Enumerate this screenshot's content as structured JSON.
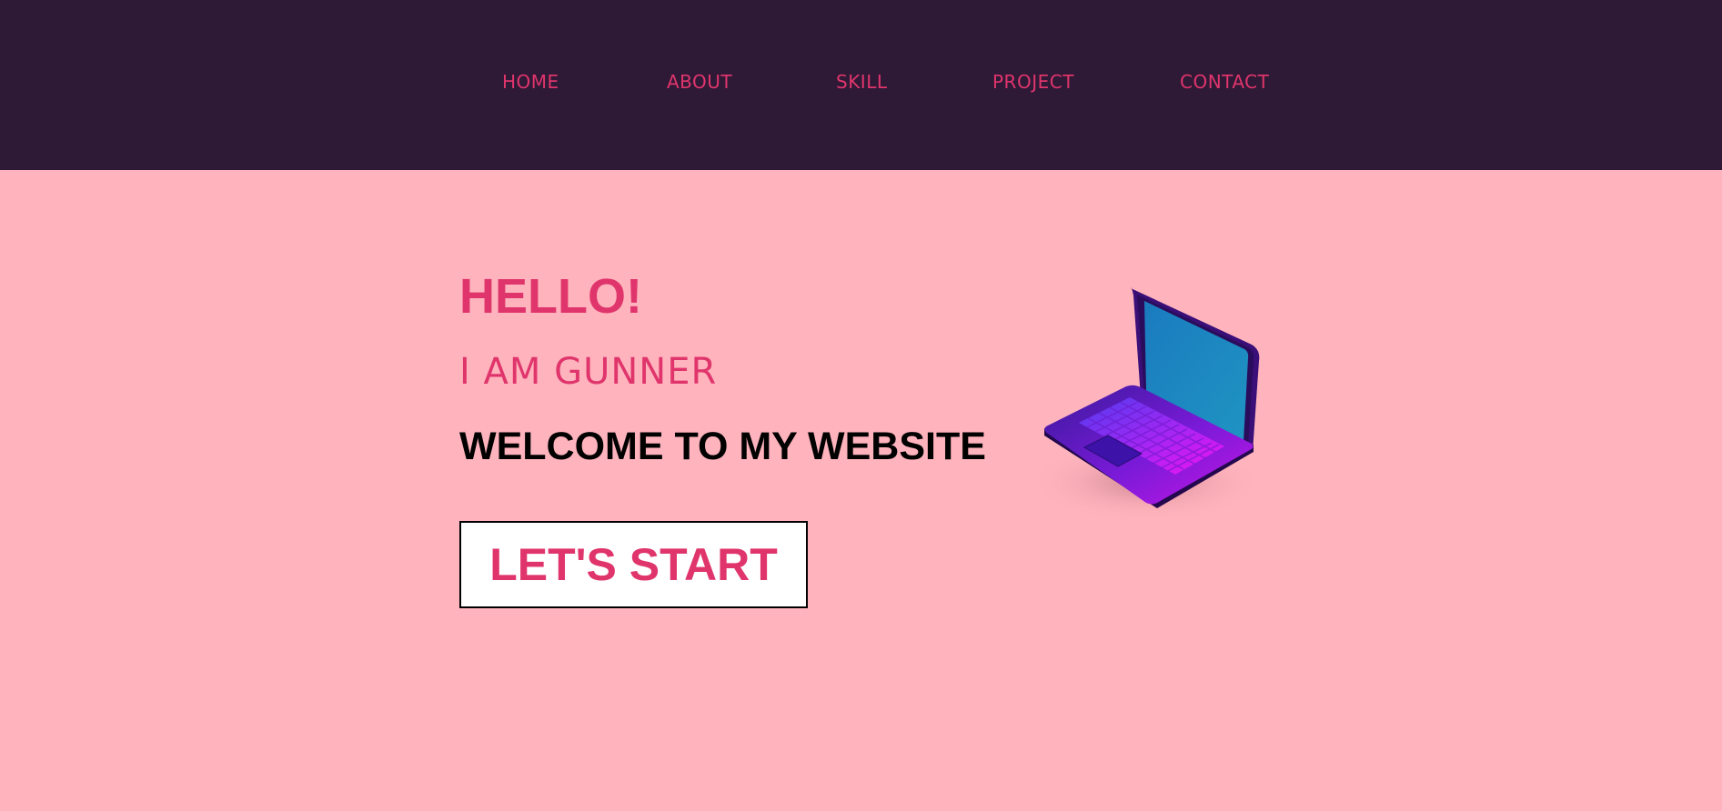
{
  "nav": {
    "items": [
      {
        "label": "HOME"
      },
      {
        "label": "ABOUT"
      },
      {
        "label": "SKILL"
      },
      {
        "label": "PROJECT"
      },
      {
        "label": "CONTACT"
      }
    ]
  },
  "hero": {
    "greeting": "HELLO!",
    "intro": "I AM GUNNER",
    "welcome": "WELCOME TO MY WEBSITE",
    "cta_label": "LET'S START",
    "illustration_icon": "laptop-icon"
  },
  "colors": {
    "nav_bg": "#2e1936",
    "page_bg": "#ffb3bd",
    "accent": "#e0356c",
    "text_dark": "#000000",
    "button_bg": "#ffffff"
  }
}
